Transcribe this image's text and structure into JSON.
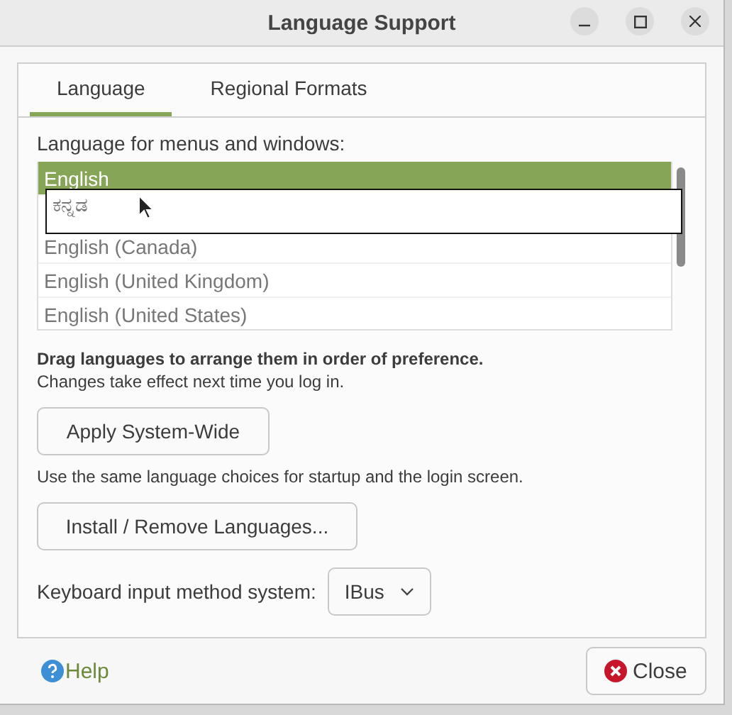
{
  "window": {
    "title": "Language Support"
  },
  "tabs": [
    {
      "label": "Language",
      "selected": true
    },
    {
      "label": "Regional Formats",
      "selected": false
    }
  ],
  "language_list": {
    "label": "Language for menus and windows:",
    "items": [
      {
        "label": "English",
        "selected": true
      },
      {
        "label": "English (Canada)",
        "selected": false
      },
      {
        "label": "English (United Kingdom)",
        "selected": false
      },
      {
        "label": "English (United States)",
        "selected": false
      }
    ],
    "drag_item": {
      "label": "ಕನ್ನಡ"
    }
  },
  "drag_hint": "Drag languages to arrange them in order of preference.",
  "drag_note": "Changes take effect next time you log in.",
  "apply_button": "Apply System-Wide",
  "apply_note": "Use the same language choices for startup and the login screen.",
  "install_button": "Install / Remove Languages...",
  "input_method": {
    "label": "Keyboard input method system:",
    "value": "IBus"
  },
  "help": "Help",
  "close_button": "Close"
}
